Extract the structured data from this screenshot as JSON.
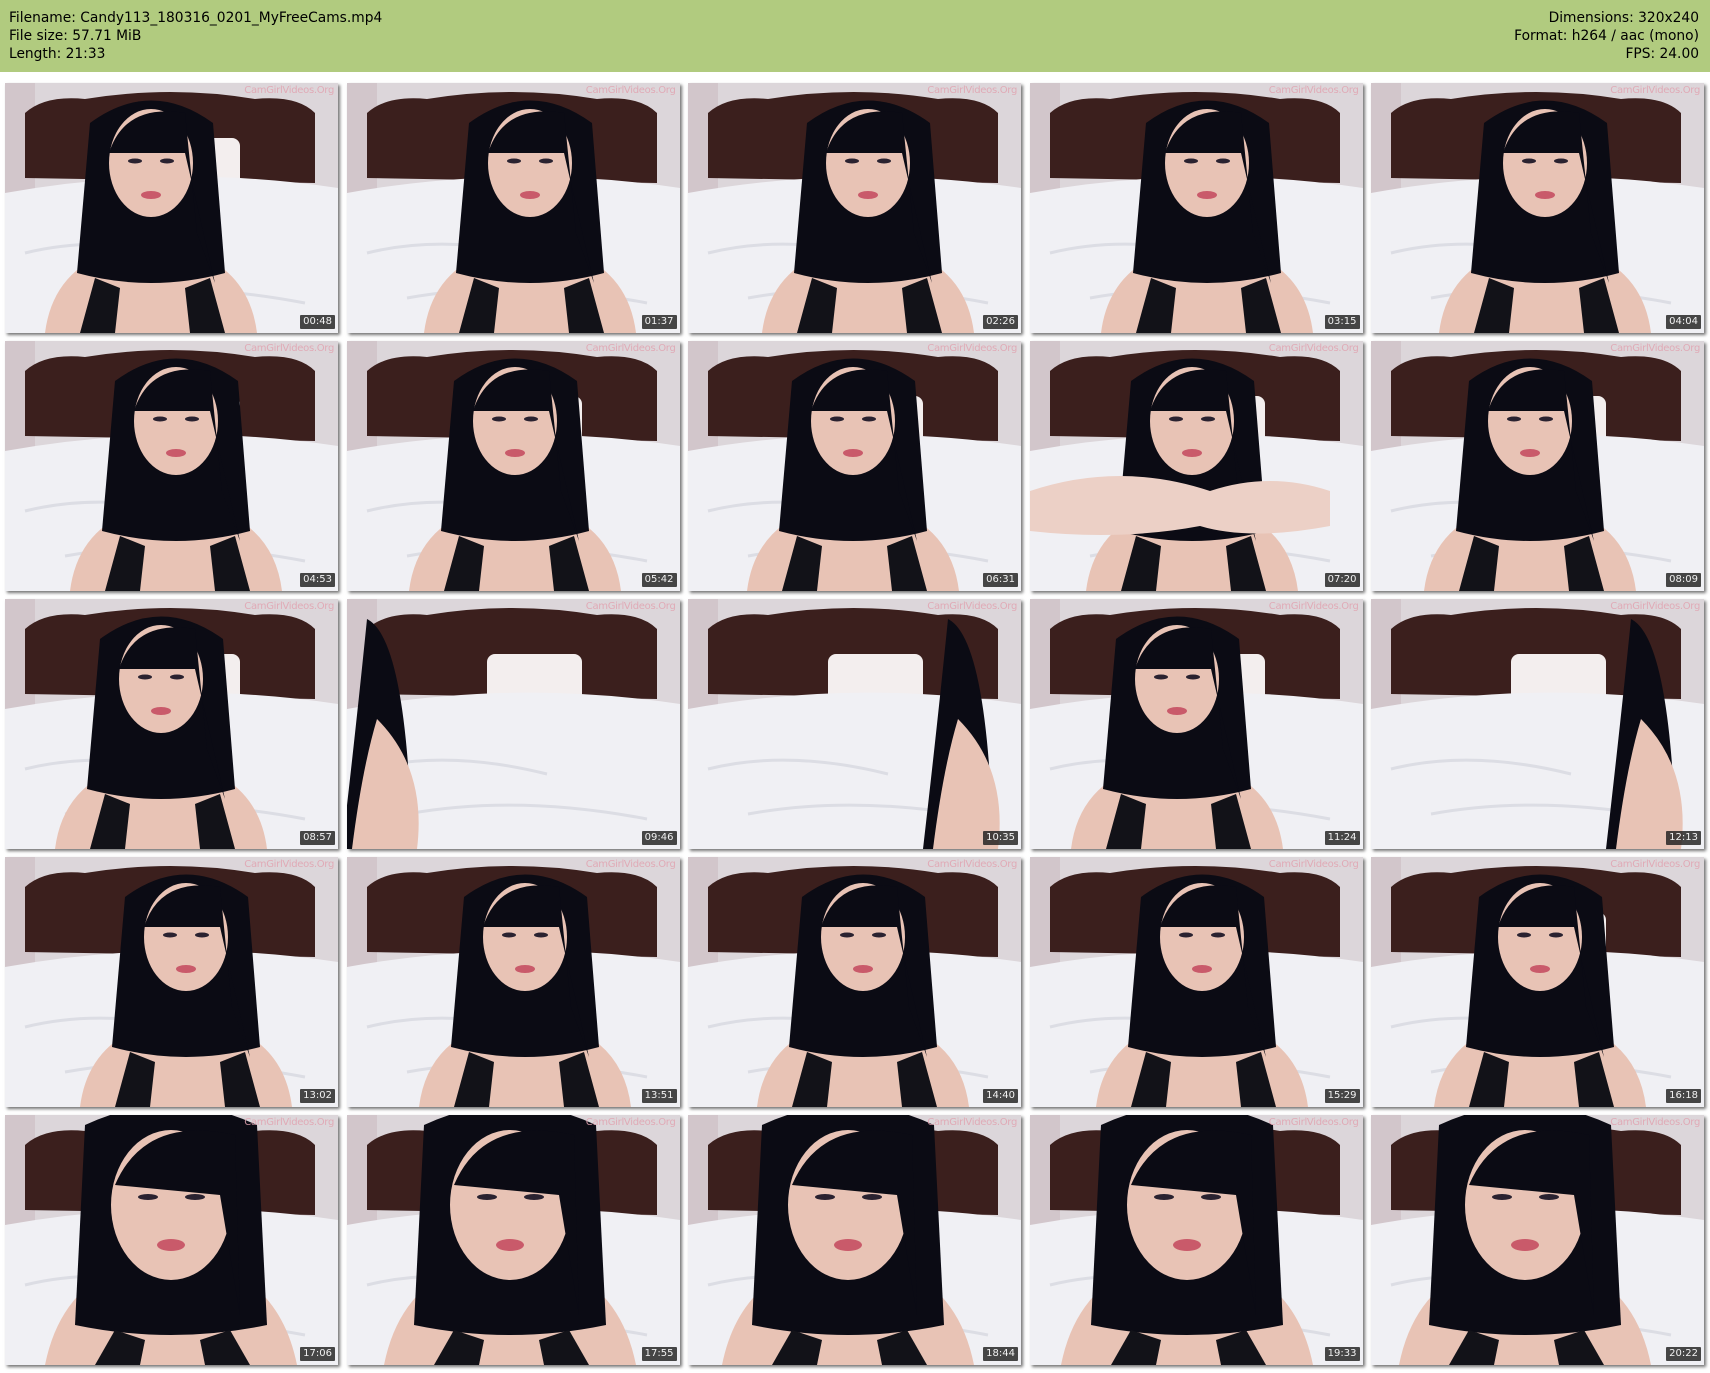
{
  "header": {
    "filename": "Filename: Candy113_180316_0201_MyFreeCams.mp4",
    "filesize": "File size: 57.71 MiB",
    "length": "Length: 21:33",
    "dimensions": "Dimensions: 320x240",
    "format": "Format: h264 / aac (mono)",
    "fps": "FPS: 24.00"
  },
  "colors": {
    "header_bg": "#b1cb7f",
    "wall": "#dcd6da",
    "headboard": "#3b1f1d",
    "sheet": "#f0f0f4",
    "hair": "#0b0b14",
    "skin": "#e8c3b5",
    "lingerie": "#121218"
  },
  "thumbnails": [
    {
      "timestamp": "00:48",
      "watermark": "CamGirlVideos.Org",
      "scene": "portrait"
    },
    {
      "timestamp": "01:37",
      "watermark": "CamGirlVideos.Org",
      "scene": "portrait"
    },
    {
      "timestamp": "02:26",
      "watermark": "CamGirlVideos.Org",
      "scene": "portrait"
    },
    {
      "timestamp": "03:15",
      "watermark": "CamGirlVideos.Org",
      "scene": "portrait"
    },
    {
      "timestamp": "04:04",
      "watermark": "CamGirlVideos.Org",
      "scene": "portrait"
    },
    {
      "timestamp": "04:53",
      "watermark": "CamGirlVideos.Org",
      "scene": "portrait"
    },
    {
      "timestamp": "05:42",
      "watermark": "CamGirlVideos.Org",
      "scene": "portrait"
    },
    {
      "timestamp": "06:31",
      "watermark": "CamGirlVideos.Org",
      "scene": "portrait"
    },
    {
      "timestamp": "07:20",
      "watermark": "CamGirlVideos.Org",
      "scene": "hands"
    },
    {
      "timestamp": "08:09",
      "watermark": "CamGirlVideos.Org",
      "scene": "portrait"
    },
    {
      "timestamp": "08:57",
      "watermark": "CamGirlVideos.Org",
      "scene": "portrait"
    },
    {
      "timestamp": "09:46",
      "watermark": "CamGirlVideos.Org",
      "scene": "bed"
    },
    {
      "timestamp": "10:35",
      "watermark": "CamGirlVideos.Org",
      "scene": "bed"
    },
    {
      "timestamp": "11:24",
      "watermark": "CamGirlVideos.Org",
      "scene": "portrait"
    },
    {
      "timestamp": "12:13",
      "watermark": "CamGirlVideos.Org",
      "scene": "bed"
    },
    {
      "timestamp": "13:02",
      "watermark": "CamGirlVideos.Org",
      "scene": "portrait"
    },
    {
      "timestamp": "13:51",
      "watermark": "CamGirlVideos.Org",
      "scene": "portrait"
    },
    {
      "timestamp": "14:40",
      "watermark": "CamGirlVideos.Org",
      "scene": "portrait"
    },
    {
      "timestamp": "15:29",
      "watermark": "CamGirlVideos.Org",
      "scene": "portrait"
    },
    {
      "timestamp": "16:18",
      "watermark": "CamGirlVideos.Org",
      "scene": "portrait"
    },
    {
      "timestamp": "17:06",
      "watermark": "CamGirlVideos.Org",
      "scene": "closeup"
    },
    {
      "timestamp": "17:55",
      "watermark": "CamGirlVideos.Org",
      "scene": "closeup"
    },
    {
      "timestamp": "18:44",
      "watermark": "CamGirlVideos.Org",
      "scene": "closeup"
    },
    {
      "timestamp": "19:33",
      "watermark": "CamGirlVideos.Org",
      "scene": "closeup"
    },
    {
      "timestamp": "20:22",
      "watermark": "CamGirlVideos.Org",
      "scene": "closeup"
    }
  ]
}
